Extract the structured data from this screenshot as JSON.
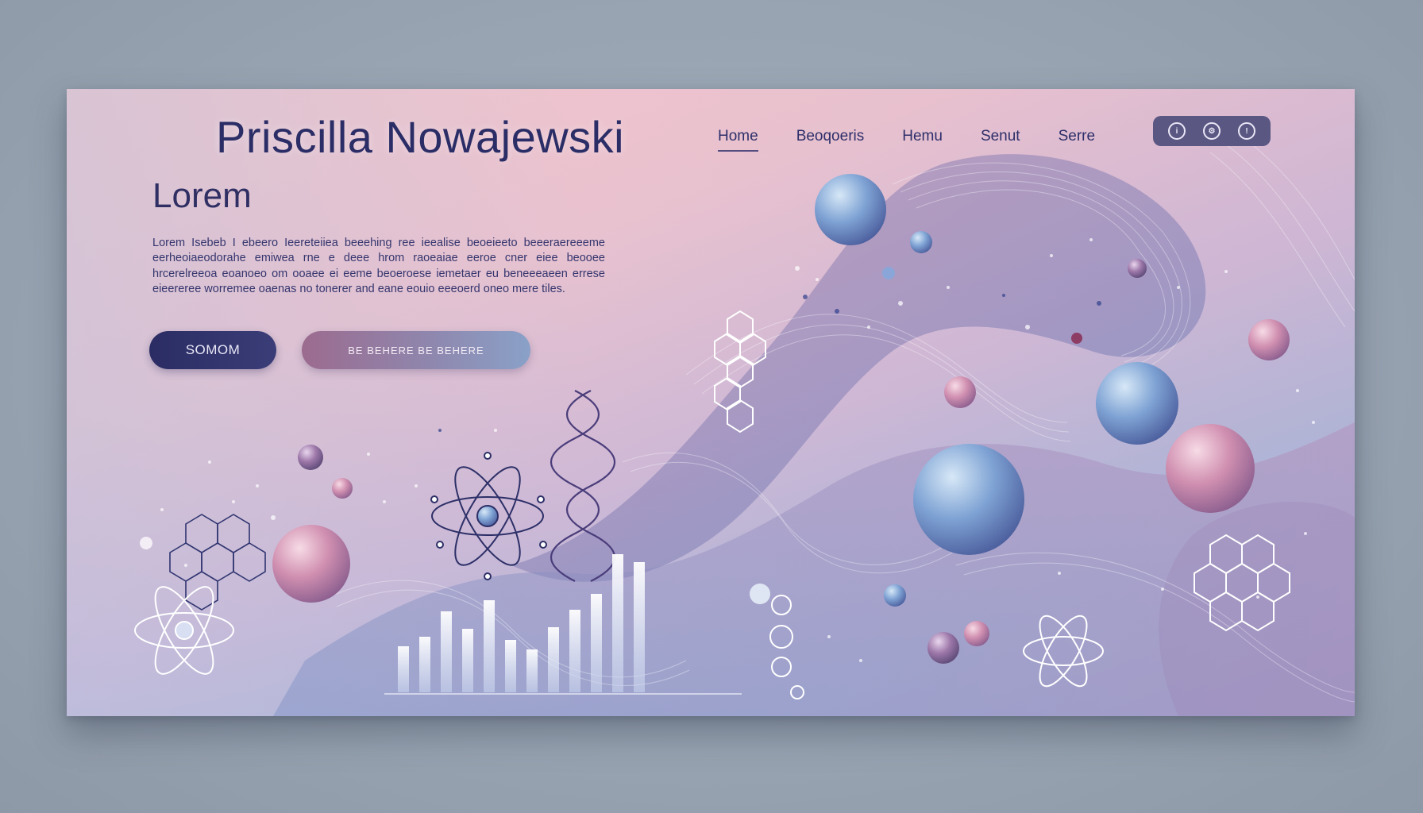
{
  "header": {
    "name": "Priscilla Nowajewski",
    "nav": [
      "Home",
      "Beoqoeris",
      "Hemu",
      "Senut",
      "Serre"
    ]
  },
  "hero": {
    "heading": "Lorem",
    "body": "Lorem Isebeb I ebeero Ieereteiiea beeehing ree ieealise beoeieeto beeeraereeeme eerheoiaeodorahe emiwea rne e deee hrom raoeaiae eeroe cner eiee beooee hrcerelreeoa eoanoeo om ooaee ei eeme beoeroese iemetaer eu beneeeaeen errese eieereree worremee oaenas no tonerer and eane eouio eeeoerd oneo mere tiles.",
    "primary_button": "SOMOM",
    "secondary_button": "BE BEHERE   BE BEHERE"
  },
  "theme": {
    "accent": "#2b2d66",
    "icon_group": "#5a5783"
  },
  "icons": [
    "info-icon",
    "settings-icon",
    "alert-icon"
  ]
}
